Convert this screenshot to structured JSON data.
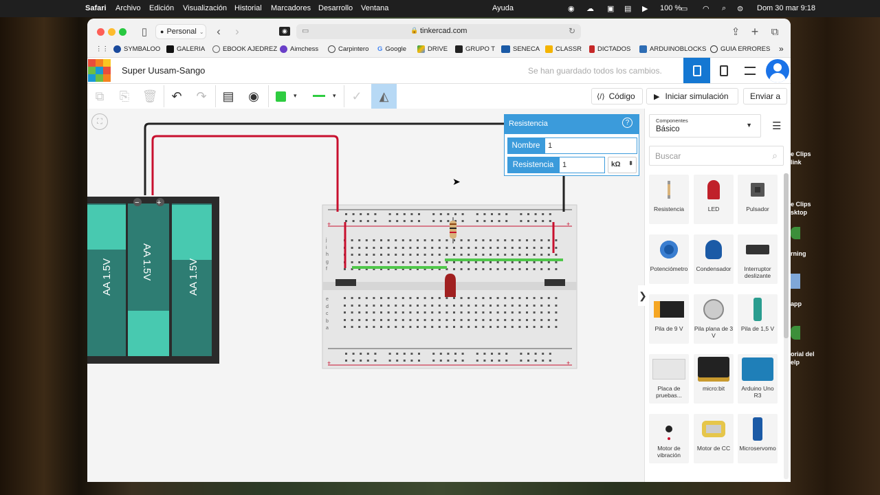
{
  "menubar": {
    "items": [
      "Safari",
      "Archivo",
      "Edición",
      "Visualización",
      "Historial",
      "Marcadores",
      "Desarrollo",
      "Ventana"
    ],
    "help": "Ayuda",
    "battery": "100 %",
    "datetime": "Dom 30 mar 9:18"
  },
  "browser": {
    "profile": "Personal",
    "url": "tinkercad.com",
    "bookmarks": [
      "SYMBALOO",
      "GALERIA",
      "EBOOK AJEDREZ",
      "Aimchess",
      "Carpintero",
      "Google",
      "DRIVE",
      "GRUPO T",
      "SENECA",
      "CLASSR",
      "DICTADOS",
      "ARDUINOBLOCKS",
      "GUIA ERRORES"
    ]
  },
  "app": {
    "logo": [
      "TIN",
      "KER",
      "CAD"
    ],
    "project_title": "Super Uusam-Sango",
    "save_status": "Se han guardado todos los cambios.",
    "code_button": "Código",
    "simulate_button": "Iniciar simulación",
    "send_button": "Enviar a"
  },
  "inspector": {
    "title": "Resistencia",
    "help": "?",
    "name_label": "Nombre",
    "name_value": "1",
    "resistance_label": "Resistencia",
    "resistance_value": "1",
    "unit": "kΩ"
  },
  "panel": {
    "category_label": "Componentes",
    "category_value": "Básico",
    "search_placeholder": "Buscar",
    "components": [
      {
        "label": "Resistencia",
        "icon": "resistor-icon"
      },
      {
        "label": "LED",
        "icon": "led-icon"
      },
      {
        "label": "Pulsador",
        "icon": "pushbutton-icon"
      },
      {
        "label": "Potenciómetro",
        "icon": "potentiometer-icon"
      },
      {
        "label": "Condensador",
        "icon": "capacitor-icon"
      },
      {
        "label": "Interruptor deslizante",
        "icon": "slide-switch-icon"
      },
      {
        "label": "Pila de 9 V",
        "icon": "battery-9v-icon"
      },
      {
        "label": "Pila plana de 3 V",
        "icon": "coin-cell-icon"
      },
      {
        "label": "Pila de 1,5 V",
        "icon": "battery-aa-icon"
      },
      {
        "label": "Placa de pruebas...",
        "icon": "breadboard-icon"
      },
      {
        "label": "micro:bit",
        "icon": "microbit-icon"
      },
      {
        "label": "Arduino Uno R3",
        "icon": "arduino-icon"
      },
      {
        "label": "Motor de vibración",
        "icon": "vibration-motor-icon"
      },
      {
        "label": "Motor de CC",
        "icon": "dc-motor-icon"
      },
      {
        "label": "Microservomo",
        "icon": "servo-icon"
      }
    ]
  },
  "battery_pack": {
    "cells": [
      "AA 1.5V",
      "AA 1.5V",
      "AA 1.5V"
    ],
    "minus": "−",
    "plus": "+"
  },
  "breadboard": {
    "row_labels_top": [
      "j",
      "i",
      "h",
      "g",
      "f"
    ],
    "row_labels_bottom": [
      "e",
      "d",
      "c",
      "b",
      "a"
    ]
  },
  "desktop": {
    "labels": [
      "e Clips",
      "link",
      "e Clips",
      "sktop",
      "rning",
      "app",
      "orial del",
      "elp"
    ]
  },
  "colors": {
    "tinkercad_blue": "#1477d2",
    "inspector_blue": "#3b9bdb",
    "wire_red": "#c8102e",
    "wire_black": "#222222",
    "battery_teal": "#48c9b0"
  }
}
